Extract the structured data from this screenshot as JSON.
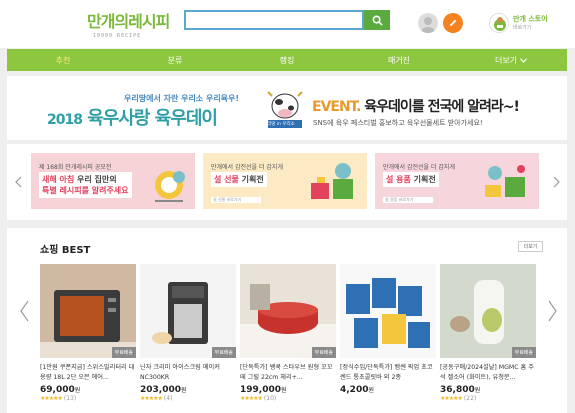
{
  "header": {
    "logo": "만개의레시피",
    "logo_sub": "10000 RECIPE",
    "search_placeholder": "",
    "store_title": "만개 스토어",
    "store_sub": "바로가기"
  },
  "nav": [
    "추천",
    "분류",
    "랭킹",
    "매거진",
    "더보기"
  ],
  "banner": {
    "small": "우리땅에서 자란 우리소 우리육우!",
    "year": "2018",
    "big": "육우사랑 육우데이",
    "cow_caption": "우리땅 in 우리소",
    "event_label": "EVENT.",
    "event_title": "육우데이를 전국에 알려라~!",
    "sub": "SNS에 육우 페스티벌 홍보하고 육우선물세트 받아가세요!"
  },
  "promos": [
    {
      "small": "제 168회 만개레시피 공모전",
      "line1": "새해 아침",
      "line1b": "우리 집만의",
      "line2": "특별 레시피를 알려주세요",
      "bar": "응모 기간 보기",
      "bg": "#f5d3d7"
    },
    {
      "small": "만개에서 감전선을 더 갑지게",
      "line1": "설 선물",
      "line1b": "기획전",
      "line2": "",
      "bar": "설 선물 바로가기",
      "bg": "#fbeac4"
    },
    {
      "small": "만개에서 감전선을 더 갑지게",
      "line1": "설 용품",
      "line1b": "기획전",
      "line2": "",
      "bar": "설 용품 바로가기",
      "bg": "#f7d5dd"
    }
  ],
  "shop": {
    "title": "쇼핑 BEST",
    "more": "더보기",
    "products": [
      {
        "name": "[1만원 쿠폰지급] 스위스밀리터리 대용량 18L 2단 오븐 에어...",
        "price": "69,000",
        "unit": "원",
        "stars": "★★★★★",
        "count": "(13)",
        "badge": "무료배송"
      },
      {
        "name": "닌자 크리미 아이스크림 메이커 NC300KR",
        "price": "203,000",
        "unit": "원",
        "stars": "★★★★★",
        "count": "(4)",
        "badge": "무료배송"
      },
      {
        "name": "[단독특가] 쌩쿡 스타우브 원형 꼬꼬떼 그릴 22cm 체리+...",
        "price": "199,000",
        "unit": "원",
        "stars": "★★★★★",
        "count": "(10)",
        "badge": "무료배송"
      },
      {
        "name": "[정식수입/단독특가] 뱀쎈 픽업 초코쎈드 통초콜릿바 외 2종",
        "price": "4,200",
        "unit": "원",
        "stars": "",
        "count": "",
        "badge": ""
      },
      {
        "name": "[공동구매/2024설날] MGMC 홈 주석 젤소어 (화이트), 유청분...",
        "price": "36,800",
        "unit": "원",
        "stars": "★★★★★",
        "count": "(22)",
        "badge": "무료배송"
      }
    ]
  },
  "colors": {
    "brand_green": "#8dc63f",
    "search_blue": "#5aa7d6",
    "write_orange": "#f5811f"
  }
}
